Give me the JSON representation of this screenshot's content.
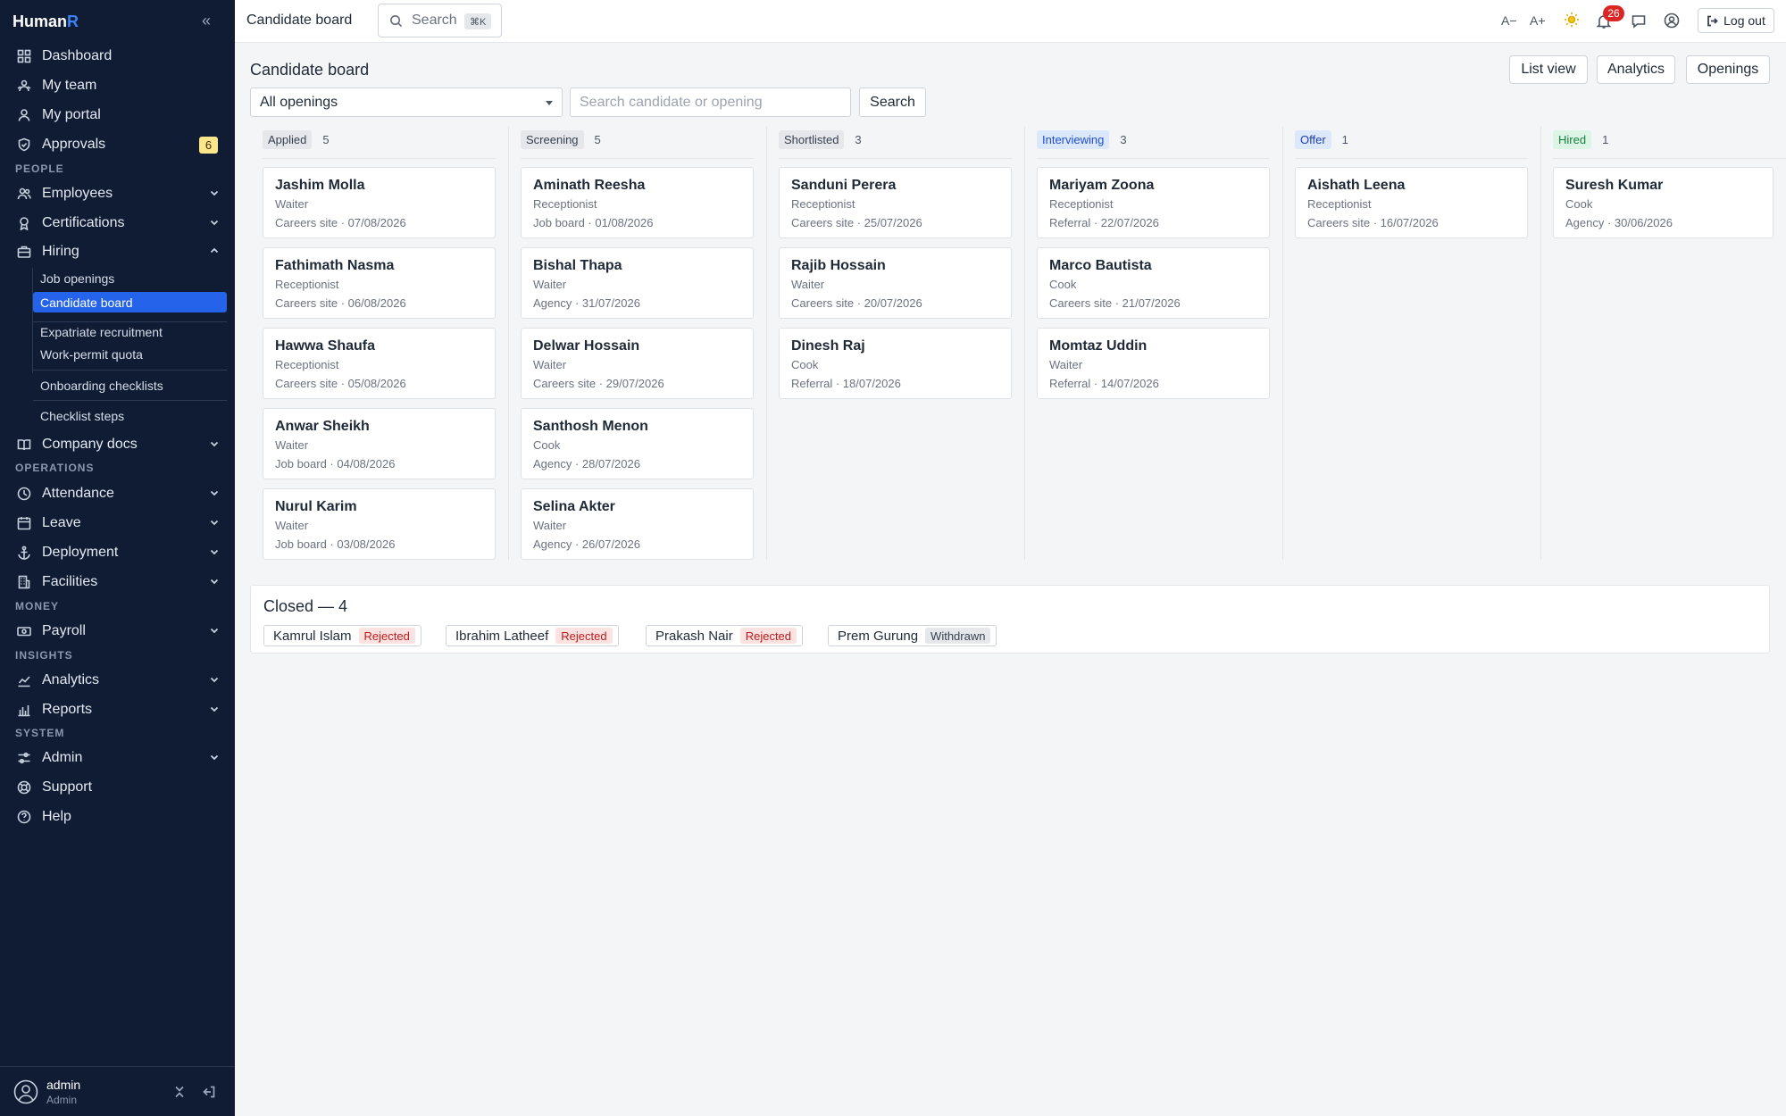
{
  "app": {
    "brand_main": "Human",
    "brand_accent": "R"
  },
  "sidebar": {
    "items": [
      {
        "label": "Dashboard",
        "icon": "dashboard-icon",
        "chevron": false
      },
      {
        "label": "My team",
        "icon": "team-icon",
        "chevron": false
      },
      {
        "label": "My portal",
        "icon": "user-icon",
        "chevron": false
      },
      {
        "label": "Approvals",
        "icon": "shield-check-icon",
        "badge": "6"
      }
    ],
    "sections": {
      "people": "PEOPLE",
      "operations": "OPERATIONS",
      "money": "MONEY",
      "insights": "INSIGHTS",
      "system": "SYSTEM"
    },
    "people_items": [
      {
        "label": "Employees",
        "icon": "users-icon"
      },
      {
        "label": "Certifications",
        "icon": "award-icon"
      },
      {
        "label": "Hiring",
        "icon": "briefcase-icon",
        "expanded": true
      }
    ],
    "hiring_sub": [
      "Job openings",
      "Candidate board",
      "Expatriate recruitment",
      "Work-permit quota",
      "Onboarding checklists",
      "Checklist steps"
    ],
    "company_docs": "Company docs",
    "operations_items": [
      "Attendance",
      "Leave",
      "Deployment",
      "Facilities"
    ],
    "money_items": [
      "Payroll"
    ],
    "insights_items": [
      "Analytics",
      "Reports"
    ],
    "system_items": [
      "Admin",
      "Support",
      "Help"
    ],
    "user": {
      "name": "admin",
      "role": "Admin"
    }
  },
  "topbar": {
    "title": "Candidate board",
    "search_label": "Search",
    "shortcut": "⌘K",
    "font_decrease": "A−",
    "font_increase": "A+",
    "notifications_count": "26",
    "logout": "Log out"
  },
  "page": {
    "title": "Candidate board",
    "buttons": {
      "list_view": "List view",
      "analytics": "Analytics",
      "openings": "Openings"
    },
    "filter_value": "All openings",
    "search_placeholder": "Search candidate or opening",
    "search_button": "Search"
  },
  "colors": {
    "sidebar_bg": "#0f1c33",
    "accent": "#2563eb",
    "interviewing_bg": "#dbe8fb",
    "interviewing_fg": "#1d4ed8",
    "offer_bg": "#dde9fb",
    "offer_fg": "#1e40af",
    "hired_bg": "#dcf5e4",
    "hired_fg": "#15803d",
    "rejected_bg": "#fde2e2",
    "rejected_fg": "#b91c1c",
    "withdrawn_bg": "#e5e7eb",
    "withdrawn_fg": "#374151"
  },
  "board": {
    "columns": [
      {
        "stage": "Applied",
        "count": "5",
        "cards": [
          {
            "name": "Jashim Molla",
            "role": "Waiter",
            "meta": "Careers site · 07/08/2026"
          },
          {
            "name": "Fathimath Nasma",
            "role": "Receptionist",
            "meta": "Careers site · 06/08/2026"
          },
          {
            "name": "Hawwa Shaufa",
            "role": "Receptionist",
            "meta": "Careers site · 05/08/2026"
          },
          {
            "name": "Anwar Sheikh",
            "role": "Waiter",
            "meta": "Job board · 04/08/2026"
          },
          {
            "name": "Nurul Karim",
            "role": "Waiter",
            "meta": "Job board · 03/08/2026"
          }
        ]
      },
      {
        "stage": "Screening",
        "count": "5",
        "cards": [
          {
            "name": "Aminath Reesha",
            "role": "Receptionist",
            "meta": "Job board · 01/08/2026"
          },
          {
            "name": "Bishal Thapa",
            "role": "Waiter",
            "meta": "Agency · 31/07/2026"
          },
          {
            "name": "Delwar Hossain",
            "role": "Waiter",
            "meta": "Careers site · 29/07/2026"
          },
          {
            "name": "Santhosh Menon",
            "role": "Cook",
            "meta": "Agency · 28/07/2026"
          },
          {
            "name": "Selina Akter",
            "role": "Waiter",
            "meta": "Agency · 26/07/2026"
          }
        ]
      },
      {
        "stage": "Shortlisted",
        "count": "3",
        "cards": [
          {
            "name": "Sanduni Perera",
            "role": "Receptionist",
            "meta": "Careers site · 25/07/2026"
          },
          {
            "name": "Rajib Hossain",
            "role": "Waiter",
            "meta": "Careers site · 20/07/2026"
          },
          {
            "name": "Dinesh Raj",
            "role": "Cook",
            "meta": "Referral · 18/07/2026"
          }
        ]
      },
      {
        "stage": "Interviewing",
        "count": "3",
        "cards": [
          {
            "name": "Mariyam Zoona",
            "role": "Receptionist",
            "meta": "Referral · 22/07/2026"
          },
          {
            "name": "Marco Bautista",
            "role": "Cook",
            "meta": "Careers site · 21/07/2026"
          },
          {
            "name": "Momtaz Uddin",
            "role": "Waiter",
            "meta": "Referral · 14/07/2026"
          }
        ]
      },
      {
        "stage": "Offer",
        "count": "1",
        "cards": [
          {
            "name": "Aishath Leena",
            "role": "Receptionist",
            "meta": "Careers site · 16/07/2026"
          }
        ]
      },
      {
        "stage": "Hired",
        "count": "1",
        "cards": [
          {
            "name": "Suresh Kumar",
            "role": "Cook",
            "meta": "Agency · 30/06/2026"
          }
        ]
      }
    ]
  },
  "closed": {
    "title": "Closed — 4",
    "chips": [
      {
        "name": "Kamrul Islam",
        "status": "Rejected"
      },
      {
        "name": "Ibrahim Latheef",
        "status": "Rejected"
      },
      {
        "name": "Prakash Nair",
        "status": "Rejected"
      },
      {
        "name": "Prem Gurung",
        "status": "Withdrawn"
      }
    ]
  }
}
